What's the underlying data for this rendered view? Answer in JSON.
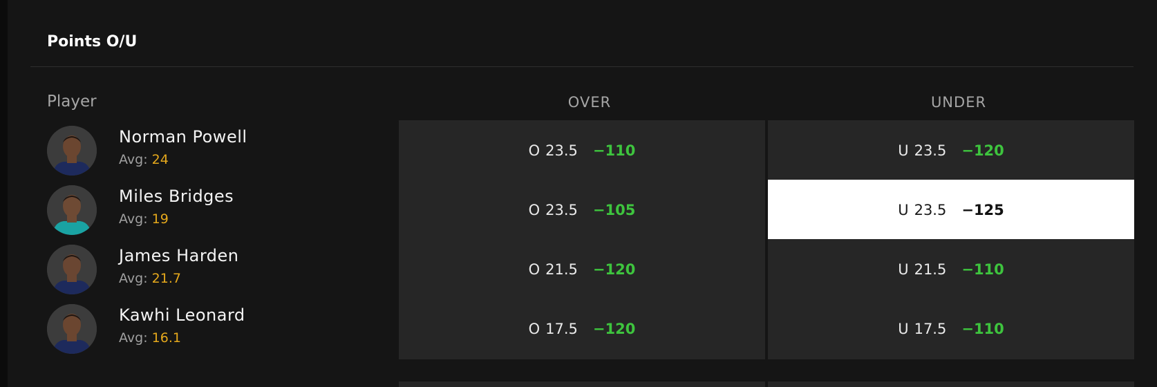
{
  "market": {
    "title": "Points O/U",
    "columns": {
      "player": "Player",
      "over": "OVER",
      "under": "UNDER"
    }
  },
  "players": [
    {
      "name": "Norman Powell",
      "avg_label": "Avg:",
      "avg": "24",
      "over": {
        "side": "O",
        "line": "23.5",
        "price": "−110"
      },
      "under": {
        "side": "U",
        "line": "23.5",
        "price": "−120"
      },
      "jersey_color": "#1d2a5c",
      "skin": "#6b4630"
    },
    {
      "name": "Miles Bridges",
      "avg_label": "Avg:",
      "avg": "19",
      "over": {
        "side": "O",
        "line": "23.5",
        "price": "−105"
      },
      "under": {
        "side": "U",
        "line": "23.5",
        "price": "−125",
        "selected": true
      },
      "jersey_color": "#1aa3a3",
      "skin": "#6e4a34"
    },
    {
      "name": "James Harden",
      "avg_label": "Avg:",
      "avg": "21.7",
      "over": {
        "side": "O",
        "line": "21.5",
        "price": "−120"
      },
      "under": {
        "side": "U",
        "line": "21.5",
        "price": "−110"
      },
      "jersey_color": "#1d2a5c",
      "skin": "#6a4632"
    },
    {
      "name": "Kawhi Leonard",
      "avg_label": "Avg:",
      "avg": "16.1",
      "over": {
        "side": "O",
        "line": "17.5",
        "price": "−120"
      },
      "under": {
        "side": "U",
        "line": "17.5",
        "price": "−110"
      },
      "jersey_color": "#1d2a5c",
      "skin": "#6b4630"
    }
  ],
  "colors": {
    "price_green": "#3ec43e",
    "avg_gold": "#e6a91c",
    "cell_bg": "#262626",
    "selected_bg": "#ffffff"
  }
}
